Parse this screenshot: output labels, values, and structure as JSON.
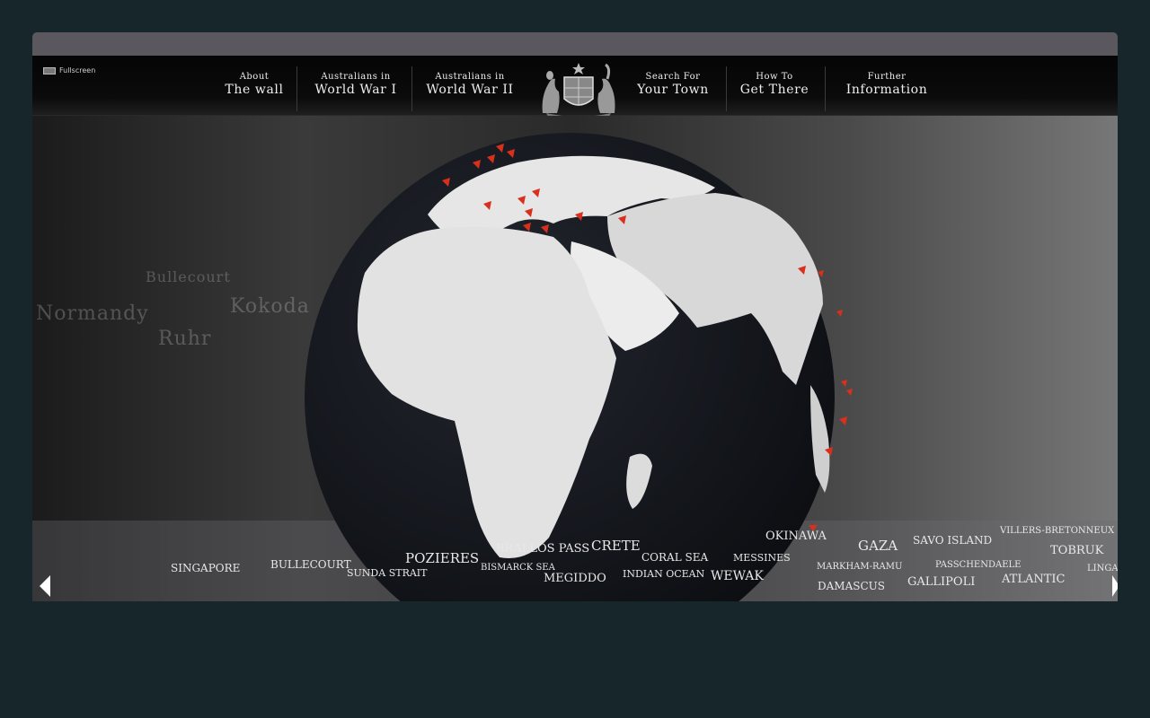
{
  "fullscreen_label": "Fullscreen",
  "nav": [
    {
      "line1": "About",
      "line2": "The wall"
    },
    {
      "line1": "Australians in",
      "line2": "World War I"
    },
    {
      "line1": "Australians in",
      "line2": "World War II"
    },
    {
      "line1": "Search For",
      "line2": "Your Town"
    },
    {
      "line1": "How To",
      "line2": "Get There"
    },
    {
      "line1": "Further",
      "line2": "Information"
    }
  ],
  "wall_names": [
    "Normandy",
    "Ruhr",
    "Kokoda",
    "Bullecourt"
  ],
  "battle_names": [
    "Singapore",
    "Bullecourt",
    "Sunda Strait",
    "Pozieres",
    "Brallos Pass",
    "Bismarck Sea",
    "Crete",
    "Megiddo",
    "Coral Sea",
    "Indian Ocean",
    "Messines",
    "Wewak",
    "Okinawa",
    "Gaza",
    "Markham-Ramu",
    "Damascus",
    "Savo Island",
    "Passchendaele",
    "Gallipoli",
    "Villers-Bretonneux",
    "Tobruk",
    "Atlantic",
    "Linga"
  ],
  "colors": {
    "background": "#16262b",
    "titlebar": "#5a585e",
    "marker": "#d8301c",
    "globe_ocean": "#161a22"
  },
  "icons": {
    "fullscreen": "fullscreen-icon",
    "crest": "coat-of-arms-icon",
    "prev": "arrow-left-icon",
    "next": "arrow-right-icon"
  }
}
